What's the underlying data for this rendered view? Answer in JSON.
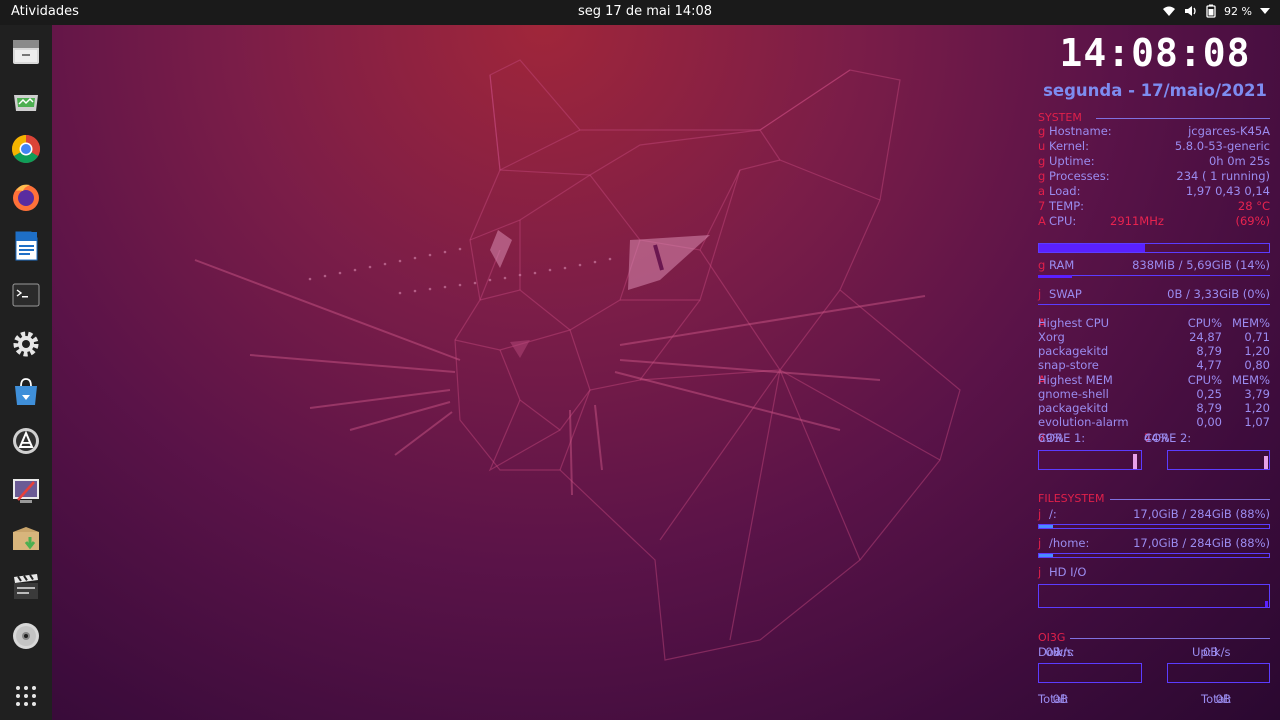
{
  "topbar": {
    "activities": "Atividades",
    "clock": "seg 17 de mai  14:08",
    "battery": "92 %",
    "icons": [
      "wifi-icon",
      "volume-icon",
      "battery-icon",
      "menu-arrow-icon"
    ]
  },
  "dock": {
    "apps": [
      "files",
      "system-monitor",
      "chrome",
      "firefox",
      "libreoffice-writer",
      "terminal",
      "settings",
      "software-store",
      "software-updater",
      "screenshot-tool",
      "archive-manager",
      "video-editor",
      "disc-burner",
      "show-applications"
    ]
  },
  "conky": {
    "time": "14:08:08",
    "date": "segunda - 17/maio/2021",
    "system": {
      "title": "SYSTEM",
      "rows": [
        {
          "glyph": "g",
          "label": "Hostname:",
          "value": "jcgarces-K45A"
        },
        {
          "glyph": "u",
          "label": "Kernel:",
          "value": "5.8.0-53-generic"
        },
        {
          "glyph": "g",
          "label": "Uptime:",
          "value": "0h 0m 25s"
        },
        {
          "glyph": "g",
          "label": "Processes:",
          "value": "234 (   1 running)"
        },
        {
          "glyph": "a",
          "label": "Load:",
          "value": "1,97 0,43 0,14"
        },
        {
          "glyph": "7",
          "label": "TEMP:",
          "value": "28 °C"
        },
        {
          "glyph": "A",
          "label": "CPU:",
          "mid": "2911MHz",
          "value": "(69%)"
        }
      ],
      "cpu_fraction": 0.69
    },
    "ram": {
      "glyph": "g",
      "label": "RAM",
      "value": "838MiB / 5,69GiB (14%)",
      "fraction": 0.14
    },
    "swap": {
      "glyph": "j",
      "label": "SWAP",
      "value": "0B   / 3,33GiB (0%)",
      "fraction": 0.0
    },
    "highest_cpu": {
      "glyph": "A",
      "title": "Highest CPU",
      "col1": "CPU%",
      "col2": "MEM%",
      "rows": [
        {
          "name": "Xorg",
          "cpu": "24,87",
          "mem": "0,71"
        },
        {
          "name": "packagekitd",
          "cpu": "8,79",
          "mem": "1,20"
        },
        {
          "name": "snap-store",
          "cpu": "4,77",
          "mem": "0,80"
        }
      ]
    },
    "highest_mem": {
      "glyph": "A",
      "title": "Highest MEM",
      "col1": "CPU%",
      "col2": "MEM%",
      "rows": [
        {
          "name": "gnome-shell",
          "cpu": "0,25",
          "mem": "3,79"
        },
        {
          "name": "packagekitd",
          "cpu": "8,79",
          "mem": "1,20"
        },
        {
          "name": "evolution-alarm",
          "cpu": "0,00",
          "mem": "1,07"
        }
      ]
    },
    "cores": {
      "glyph": "7",
      "core1_label": "CORE 1:",
      "core1_value": "69%",
      "core2_label": "CORE 2:",
      "core2_value": "44%"
    },
    "filesystem": {
      "title": "FILESYSTEM",
      "rows": [
        {
          "glyph": "j",
          "label": "/:",
          "value": "17,0GiB /  284GiB (88%)",
          "fraction": 0.06
        },
        {
          "glyph": "j",
          "label": "/home:",
          "value": "17,0GiB /  284GiB (88%)",
          "fraction": 0.06
        }
      ],
      "hdio": {
        "glyph": "j",
        "label": "HD  I/O"
      }
    },
    "network": {
      "title": "OI3G",
      "down_label": "Down:",
      "down_value": "0B",
      "down_unit": "k/s",
      "up_label": "Up:",
      "up_value": "0B",
      "up_unit": "k/s",
      "total_label": "Total:",
      "total_down": "0B",
      "total_up": "0B"
    },
    "colors": {
      "accent_red": "#e0204a",
      "text_purple": "#9b8cf0",
      "bar_blue": "#5c3cff"
    }
  }
}
